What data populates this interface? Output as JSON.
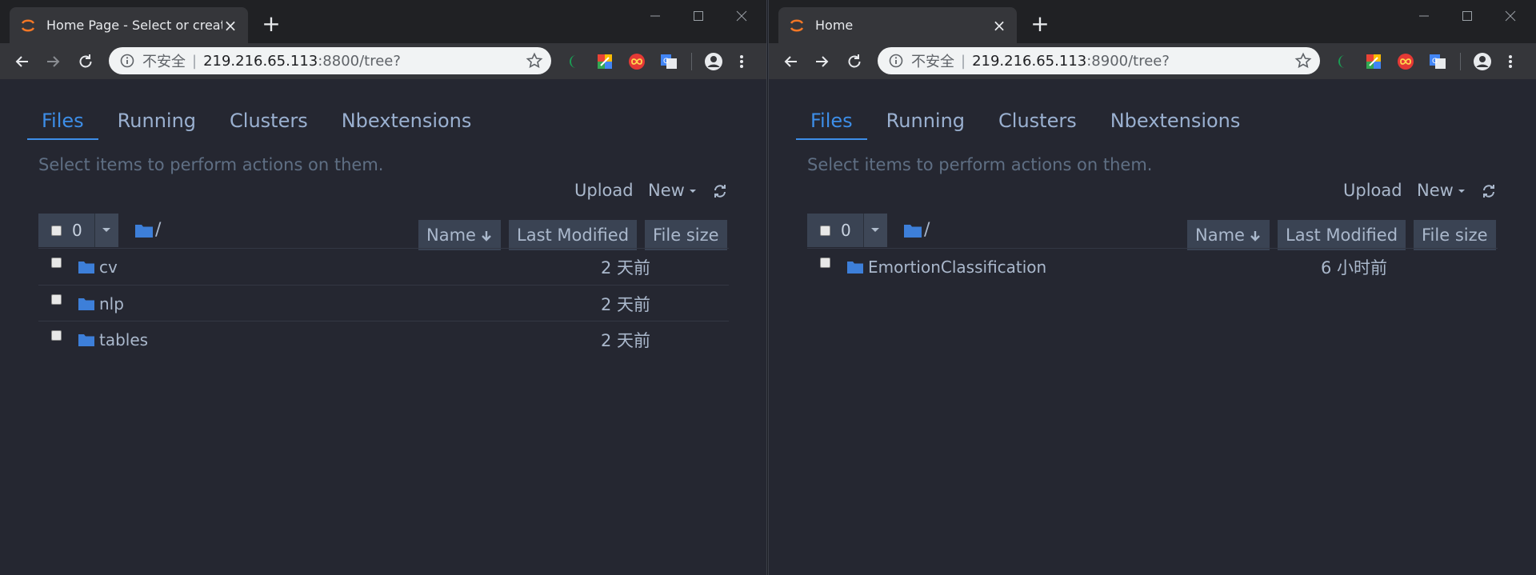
{
  "left": {
    "tab_title": "Home Page - Select or create a",
    "url_insecure": "不安全",
    "url_host": "219.216.65.113",
    "url_path": ":8800/tree?",
    "nav_tabs": [
      "Files",
      "Running",
      "Clusters",
      "Nbextensions"
    ],
    "hint": "Select items to perform actions on them.",
    "upload_label": "Upload",
    "new_label": "New",
    "selected_count": "0",
    "breadcrumb": "/",
    "columns": {
      "name": "Name",
      "modified": "Last Modified",
      "size": "File size"
    },
    "files": [
      {
        "name": "cv",
        "modified": "2 天前"
      },
      {
        "name": "nlp",
        "modified": "2 天前"
      },
      {
        "name": "tables",
        "modified": "2 天前"
      }
    ]
  },
  "right": {
    "tab_title": "Home",
    "url_insecure": "不安全",
    "url_host": "219.216.65.113",
    "url_path": ":8900/tree?",
    "nav_tabs": [
      "Files",
      "Running",
      "Clusters",
      "Nbextensions"
    ],
    "hint": "Select items to perform actions on them.",
    "upload_label": "Upload",
    "new_label": "New",
    "selected_count": "0",
    "breadcrumb": "/",
    "columns": {
      "name": "Name",
      "modified": "Last Modified",
      "size": "File size"
    },
    "files": [
      {
        "name": "EmortionClassification",
        "modified": "6 小时前"
      }
    ]
  },
  "colors": {
    "accent": "#3d8ee8",
    "page_bg": "#252731",
    "folder": "#3d7fd9"
  },
  "icons": [
    "jupyter-icon",
    "close-icon",
    "plus-icon",
    "minimize-icon",
    "maximize-icon",
    "back-icon",
    "forward-icon",
    "reload-icon",
    "info-icon",
    "star-icon",
    "profile-icon",
    "menu-icon",
    "caret-down-icon",
    "refresh-icon",
    "folder-icon",
    "arrow-down-icon"
  ]
}
